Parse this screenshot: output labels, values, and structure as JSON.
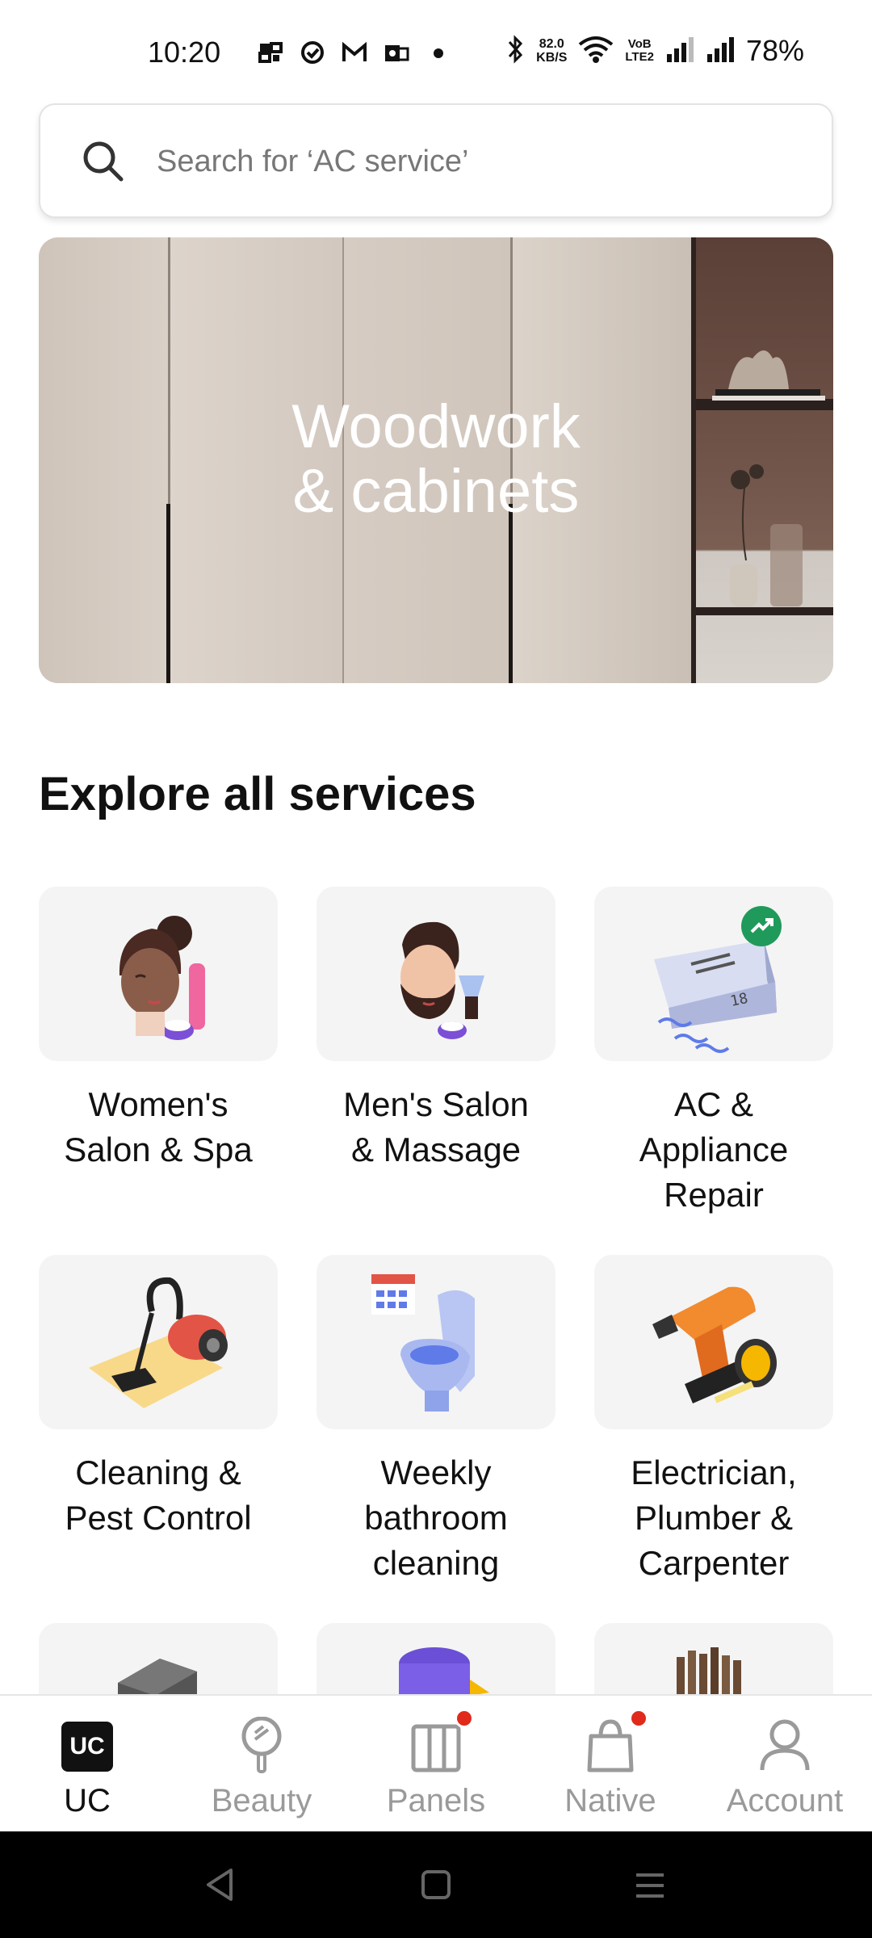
{
  "status_bar": {
    "time": "10:20",
    "net_speed_value": "82.0",
    "net_speed_unit": "KB/S",
    "vol_top": "VoB",
    "vol_bottom": "LTE2",
    "battery": "78%"
  },
  "search": {
    "placeholder": "Search for ‘AC service’"
  },
  "banner": {
    "title_line1": "Woodwork",
    "title_line2": "& cabinets"
  },
  "explore": {
    "title": "Explore all services",
    "services": [
      {
        "line1": "Women's",
        "line2": "Salon & Spa",
        "line3": "",
        "icon": "womens-salon-icon"
      },
      {
        "line1": "Men's Salon",
        "line2": "& Massage",
        "line3": "",
        "icon": "mens-salon-icon"
      },
      {
        "line1": "AC &",
        "line2": "Appliance",
        "line3": "Repair",
        "icon": "ac-repair-icon",
        "trending": true
      },
      {
        "line1": "Cleaning &",
        "line2": "Pest Control",
        "line3": "",
        "icon": "cleaning-icon"
      },
      {
        "line1": "Weekly",
        "line2": "bathroom",
        "line3": "cleaning",
        "icon": "bathroom-icon"
      },
      {
        "line1": "Electrician,",
        "line2": "Plumber &",
        "line3": "Carpenter",
        "icon": "electrician-icon"
      }
    ]
  },
  "bottom_nav": {
    "items": [
      {
        "label": "UC",
        "icon": "uc-logo-icon",
        "active": true
      },
      {
        "label": "Beauty",
        "icon": "mirror-icon",
        "active": false
      },
      {
        "label": "Panels",
        "icon": "panels-icon",
        "active": false,
        "badge": true
      },
      {
        "label": "Native",
        "icon": "shopping-bag-icon",
        "active": false,
        "badge": true
      },
      {
        "label": "Account",
        "icon": "account-icon",
        "active": false
      }
    ],
    "uc_logo_text": "UC"
  },
  "colors": {
    "accent": "#111111",
    "trending_green": "#1f9a5b",
    "badge_red": "#e02a1c",
    "inactive_gray": "#9a9a9a"
  }
}
